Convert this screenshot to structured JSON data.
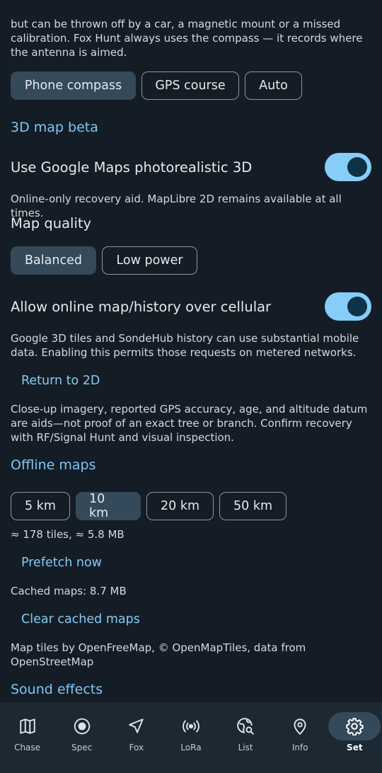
{
  "compass": {
    "description_tail": "but can be thrown off by a car, a magnetic mount or a missed calibration. Fox Hunt always uses the compass — it records where the antenna is aimed.",
    "options": [
      "Phone compass",
      "GPS course",
      "Auto"
    ],
    "selected": "Phone compass"
  },
  "map3d": {
    "section_title": "3D map beta",
    "google_toggle_label": "Use Google Maps photorealistic 3D",
    "google_toggle_on": true,
    "google_help": "Online-only recovery aid. MapLibre 2D remains available at all times.",
    "quality_label": "Map quality",
    "quality_options": [
      "Balanced",
      "Low power"
    ],
    "quality_selected": "Balanced",
    "cellular_toggle_label": "Allow online map/history over cellular",
    "cellular_toggle_on": true,
    "cellular_help": "Google 3D tiles and SondeHub history can use substantial mobile data. Enabling this permits those requests on metered networks.",
    "return_button": "Return to 2D",
    "disclaimer": "Close-up imagery, reported GPS accuracy, age, and altitude datum are aids—not proof of an exact tree or branch. Confirm recovery with RF/Signal Hunt and visual inspection."
  },
  "offline": {
    "section_title": "Offline maps",
    "radius_options": [
      "5 km",
      "10 km",
      "20 km",
      "50 km"
    ],
    "radius_selected": "10 km",
    "estimate": "≈ 178 tiles, ≈ 5.8 MB",
    "prefetch_button": "Prefetch now",
    "cached": "Cached maps: 8.7 MB",
    "clear_button": "Clear cached maps",
    "attribution": "Map tiles by OpenFreeMap, © OpenMapTiles, data from OpenStreetMap"
  },
  "next_section_title": "Sound effects",
  "nav": {
    "items": [
      {
        "label": "Chase",
        "icon": "map-icon"
      },
      {
        "label": "Spec",
        "icon": "target-icon"
      },
      {
        "label": "Fox",
        "icon": "navigation-arrow-icon"
      },
      {
        "label": "LoRa",
        "icon": "radio-waves-icon"
      },
      {
        "label": "List",
        "icon": "globe-search-icon"
      },
      {
        "label": "Info",
        "icon": "location-pin-icon"
      },
      {
        "label": "Set",
        "icon": "gear-icon"
      }
    ],
    "active": "Set"
  },
  "colors": {
    "background": "#141d25",
    "accent": "#7fc6f5",
    "toggle_track": "#86cdf9",
    "selected_segment": "#34495a",
    "navbar": "#1c2832"
  }
}
